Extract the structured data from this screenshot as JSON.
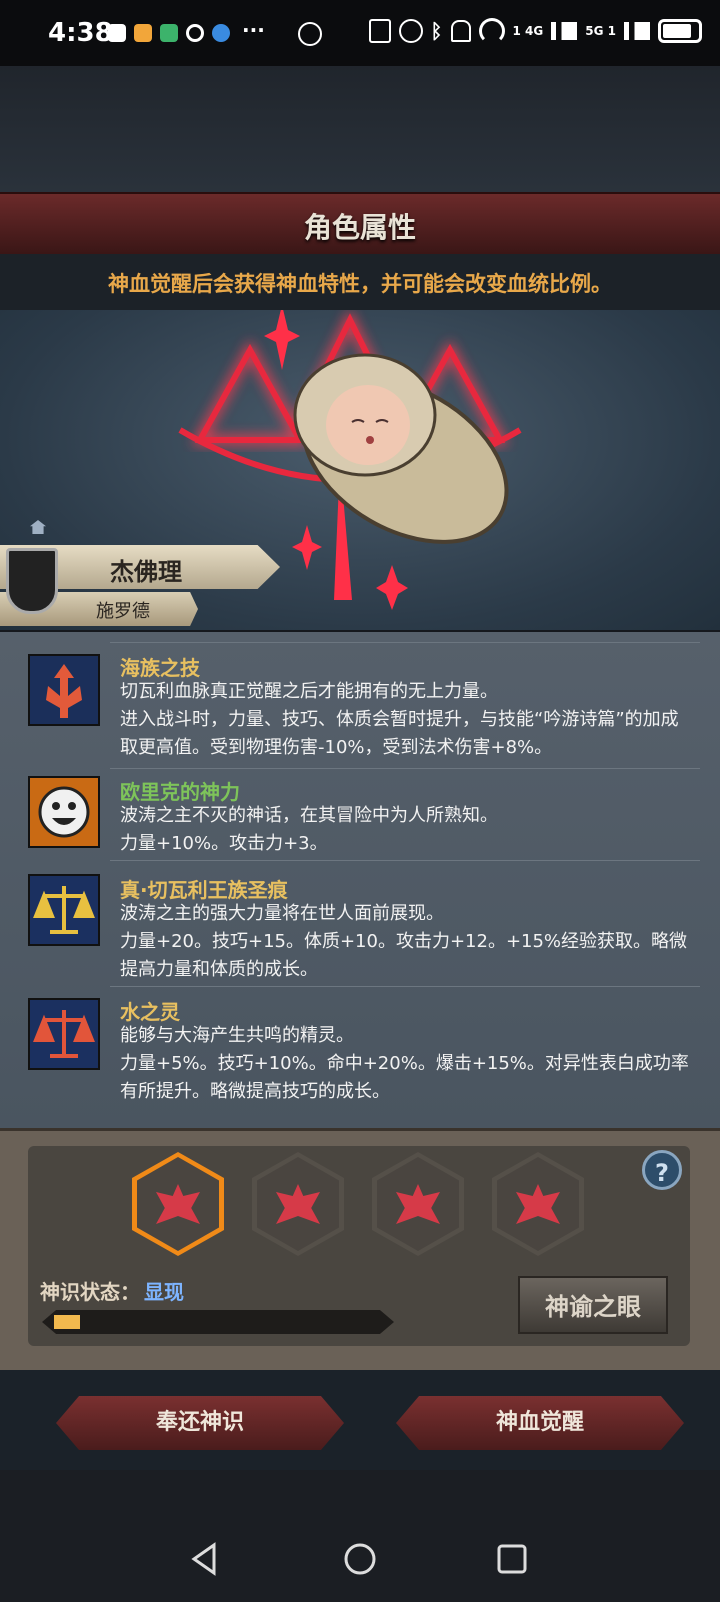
{
  "status_bar": {
    "time": "4:38",
    "network_labels": [
      "1 4G",
      "5G 1"
    ]
  },
  "header": {
    "title": "角色属性",
    "subtitle": "神血觉醒后会获得神血特性，并可能会改变血统比例。"
  },
  "character": {
    "name": "杰佛理",
    "family": "施罗德"
  },
  "traits": [
    {
      "name": "海族之技",
      "name_color": "#e8c060",
      "description": "切瓦利血脉真正觉醒之后才能拥有的无上力量。\n进入战斗时，力量、技巧、体质会暂时提升，与技能“吟游诗篇”的加成取更高值。受到物理伤害-10%，受到法术伤害+8%。",
      "icon": "trident-icon"
    },
    {
      "name": "欧里克的神力",
      "name_color": "#7ec45a",
      "description": "波涛之主不灭的神话，在其冒险中为人所熟知。\n力量+10%。攻击力+3。",
      "icon": "smiley-icon"
    },
    {
      "name": "真·切瓦利王族圣痕",
      "name_color": "#e8c060",
      "description": "波涛之主的强大力量将在世人面前展现。\n力量+20。技巧+15。体质+10。攻击力+12。+15%经验获取。略微提高力量和体质的成长。",
      "icon": "gold-scales-icon"
    },
    {
      "name": "水之灵",
      "name_color": "#e8c060",
      "description": "能够与大海产生共鸣的精灵。\n力量+5%。技巧+10%。命中+20%。爆击+15%。对异性表白成功率有所提升。略微提高技巧的成长。",
      "icon": "red-scales-icon"
    }
  ],
  "divinity": {
    "status_label": "神识状态：",
    "status_value": "显现",
    "progress": 0.08,
    "oracle_button": "神谕之眼",
    "selected_slot": 0,
    "slot_count": 4,
    "help_label": "?"
  },
  "actions": {
    "return_button": "奉还神识",
    "awaken_button": "神血觉醒"
  },
  "colors": {
    "header_red": "#6b2a2a",
    "subtitle_orange": "#e8a84a",
    "status_blue": "#7db4ff",
    "active_slot": "#f08a18"
  }
}
